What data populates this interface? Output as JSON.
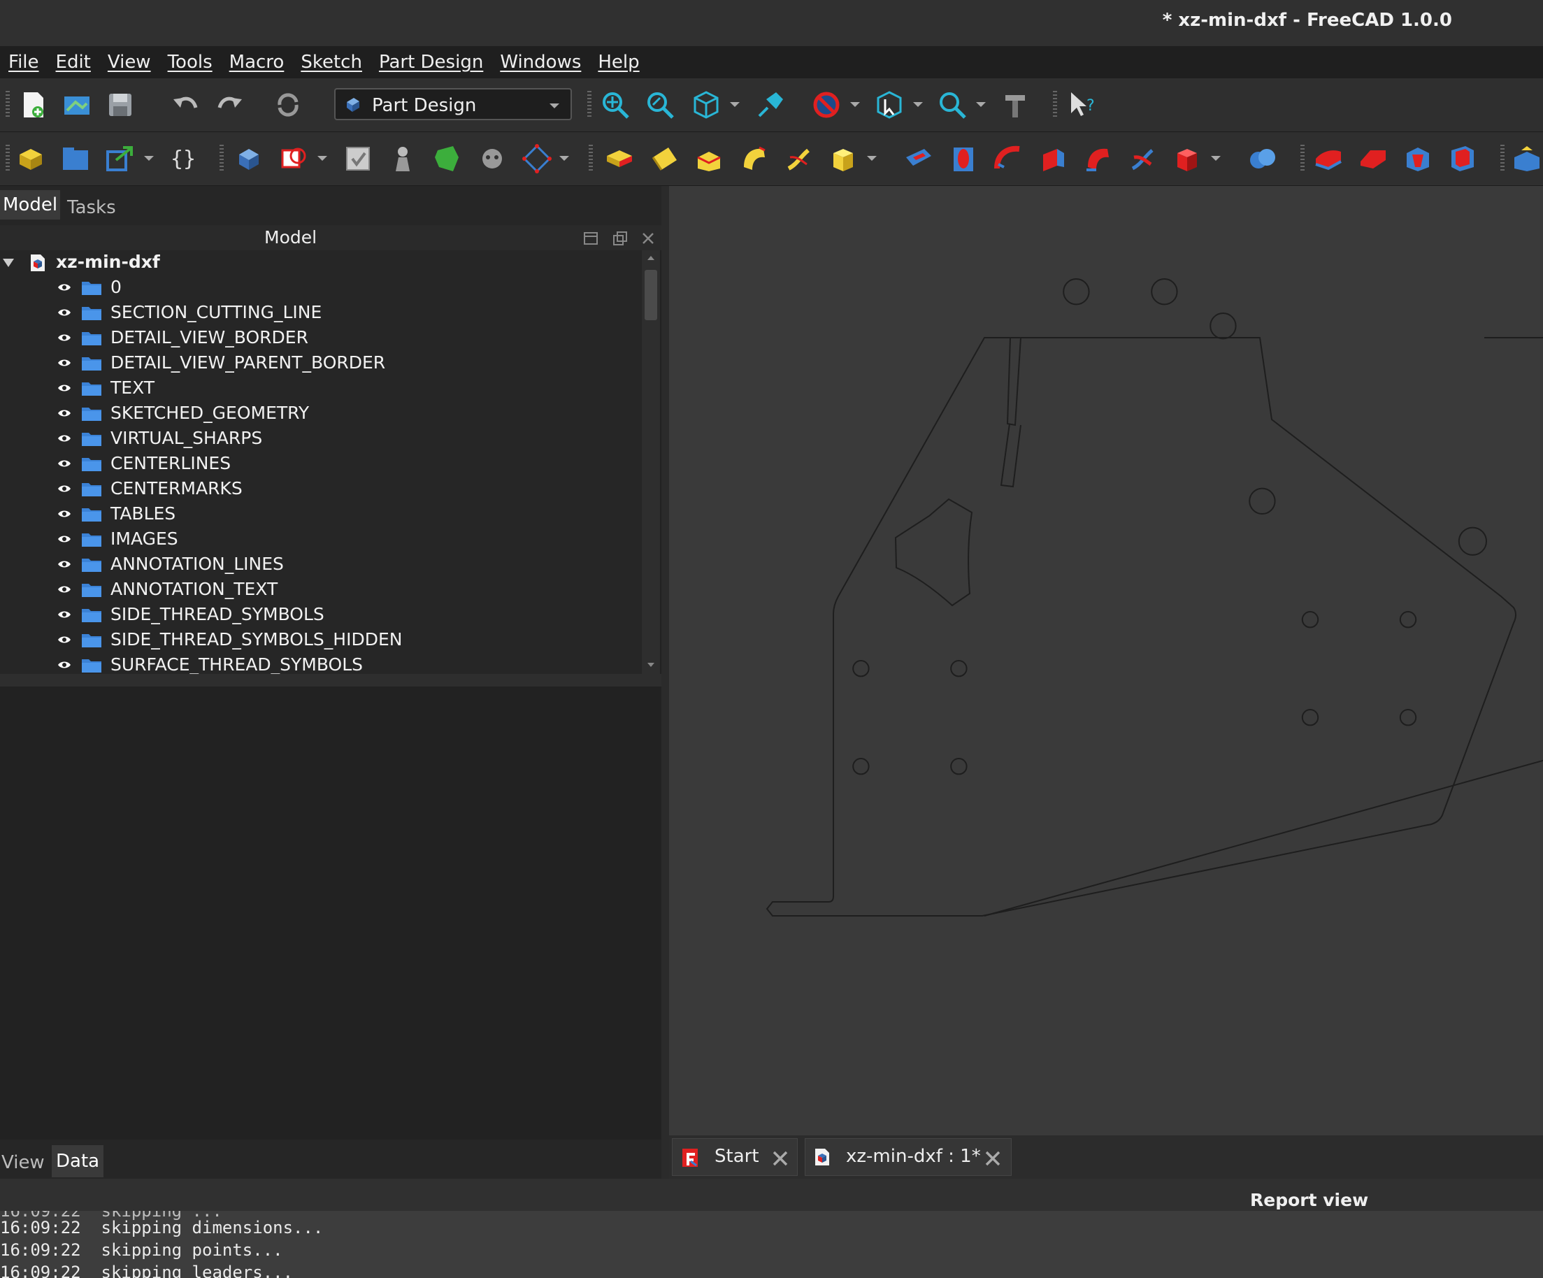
{
  "window": {
    "title": "* xz-min-dxf - FreeCAD 1.0.0"
  },
  "menu": [
    "File",
    "Edit",
    "View",
    "Tools",
    "Macro",
    "Sketch",
    "Part Design",
    "Windows",
    "Help"
  ],
  "toolbar": {
    "workbench_selector": "Part Design",
    "row1_icons": [
      "new-file-icon",
      "open-file-icon",
      "save-icon",
      "undo-icon",
      "redo-icon",
      "refresh-icon",
      "fit-all-icon",
      "fit-selection-icon",
      "isometric-view-icon",
      "measure-distance-icon",
      "draw-style-icon",
      "selection-view-icon",
      "zoom-icon",
      "measure-icon",
      "whats-this-icon"
    ],
    "row2_icons": [
      "create-body-icon",
      "create-part-icon",
      "link-icon",
      "variable-set-icon",
      "body-icon",
      "sketch-icon",
      "validate-sketch-icon",
      "datum-point-icon",
      "shape-binder-icon",
      "clone-icon",
      "datum-plane-icon",
      "pad-icon",
      "revolution-icon",
      "additive-loft-icon",
      "additive-pipe-icon",
      "additive-helix-icon",
      "additive-primitive-icon",
      "pocket-icon",
      "hole-icon",
      "groove-icon",
      "subtractive-loft-icon",
      "subtractive-pipe-icon",
      "subtractive-helix-icon",
      "subtractive-primitive-icon",
      "boolean-icon",
      "fillet-icon",
      "chamfer-icon",
      "draft-icon",
      "thickness-icon",
      "mirrored-icon"
    ]
  },
  "left_panel": {
    "tabs": [
      "Model",
      "Tasks"
    ],
    "header": "Model",
    "tree_root": "xz-min-dxf",
    "tree_items": [
      "0",
      "SECTION_CUTTING_LINE",
      "DETAIL_VIEW_BORDER",
      "DETAIL_VIEW_PARENT_BORDER",
      "TEXT",
      "SKETCHED_GEOMETRY",
      "VIRTUAL_SHARPS",
      "CENTERLINES",
      "CENTERMARKS",
      "TABLES",
      "IMAGES",
      "ANNOTATION_LINES",
      "ANNOTATION_TEXT",
      "SIDE_THREAD_SYMBOLS",
      "SIDE_THREAD_SYMBOLS_HIDDEN",
      "SURFACE_THREAD_SYMBOLS"
    ],
    "property_tabs": [
      "View",
      "Data"
    ]
  },
  "document_tabs": [
    {
      "label": "Start"
    },
    {
      "label": "xz-min-dxf : 1*"
    }
  ],
  "report_view": {
    "title": "Report view",
    "lines": [
      {
        "time": "16:09:22",
        "text": "skipping dimensions..."
      },
      {
        "time": "16:09:22",
        "text": "skipping points..."
      },
      {
        "time": "16:09:22",
        "text": "skipping leaders..."
      }
    ]
  },
  "colors": {
    "background": "#2b2b2b",
    "viewport": "#3a3a3a",
    "accent": "#3b82d6"
  }
}
